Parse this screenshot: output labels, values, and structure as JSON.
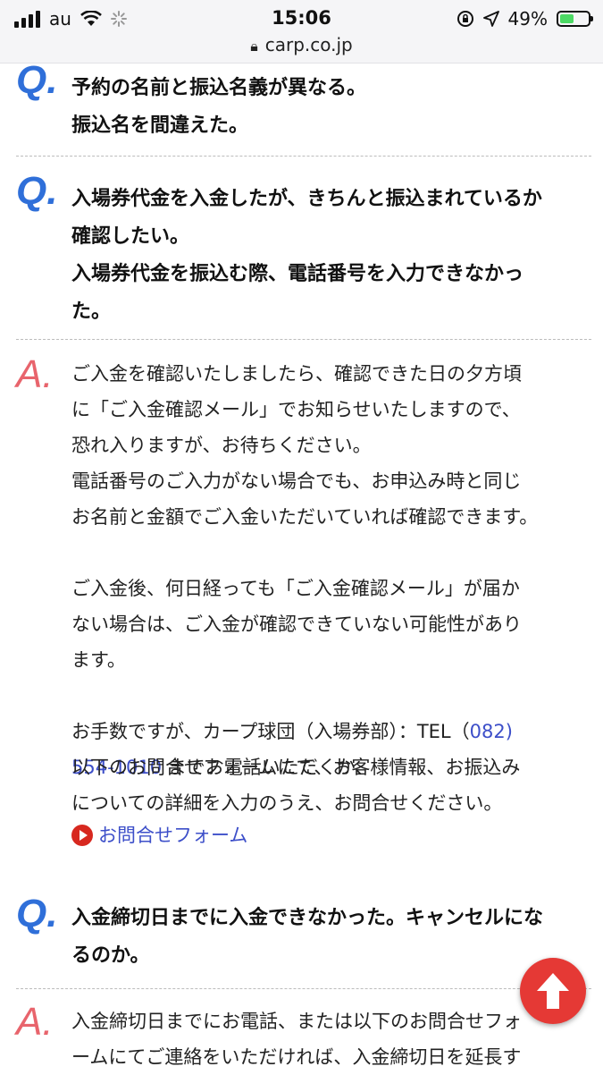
{
  "status_bar": {
    "carrier": "au",
    "time": "15:06",
    "battery_percent": "49%",
    "battery_level": 0.49,
    "url": "carp.co.jp"
  },
  "faq": {
    "q1": "予約の名前と振込名義が異なる。\n振込名を間違えた。",
    "q2": "入場券代金を入金したが、きちんと振込まれているか\n確認したい。\n入場券代金を振込む際、電話番号を入力できなかっ\nた。",
    "a2_part1": "ご入金を確認いたしましたら、確認できた日の夕方頃\nに「ご入金確認メール」でお知らせいたしますので、\n恐れ入りますが、お待ちください。\n電話番号のご入力がない場合でも、お申込み時と同じ\nお名前と金額でご入金いただいていれば確認できます。",
    "a2_part2": "ご入金後、何日経っても「ご入金確認メール」が届か\nない場合は、ご入金が確認できていない可能性があり\nます。",
    "a2_tel_prefix": "お手数ですが、カープ球団（入場券部）：TEL（",
    "a2_tel_area": "082)",
    "a2_tel_number": "554-1010",
    "a2_tel_suffix": " までお電話いただくか、",
    "a2_part3": "以下のお問合せフォームにて、お客様情報、お振込み\nについての詳細を入力のうえ、お問合せください。",
    "form_link": "お問合せフォーム",
    "q3": "入金締切日までに入金できなかった。キャンセルにな\nるのか。",
    "a3": "入金締切日までにお電話、または以下のお問合せフォ\nームにてご連絡をいただければ、入金締切日を延長す"
  },
  "marks": {
    "q": "Q.",
    "a": "A."
  },
  "colors": {
    "q_mark": "#2f6fd9",
    "a_mark": "#e8646c",
    "link": "#3d4fc9",
    "back_to_top": "#e53935"
  },
  "icons": {
    "back_to_top": "arrow-up-icon",
    "form_link": "play-circle-icon"
  }
}
